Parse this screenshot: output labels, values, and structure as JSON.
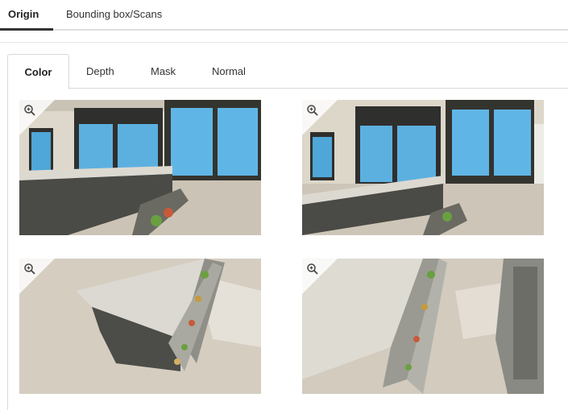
{
  "top_tabs": [
    {
      "label": "Origin",
      "active": true
    },
    {
      "label": "Bounding box/Scans",
      "active": false
    }
  ],
  "sub_tabs": [
    {
      "label": "Color",
      "active": true
    },
    {
      "label": "Depth",
      "active": false
    },
    {
      "label": "Mask",
      "active": false
    },
    {
      "label": "Normal",
      "active": false
    }
  ],
  "thumbnails": [
    {
      "icon": "zoom-in-icon",
      "content": "kitchen view 1"
    },
    {
      "icon": "zoom-in-icon",
      "content": "kitchen view 2"
    },
    {
      "icon": "zoom-in-icon",
      "content": "kitchen view 3"
    },
    {
      "icon": "zoom-in-icon",
      "content": "kitchen view 4"
    }
  ],
  "colors": {
    "active_underline": "#333333",
    "border": "#d9d9d9",
    "sky": "#4fa6d8",
    "counter": "#d8d6cf",
    "cabinet": "#4a4a46",
    "floor": "#cfc8bc"
  }
}
